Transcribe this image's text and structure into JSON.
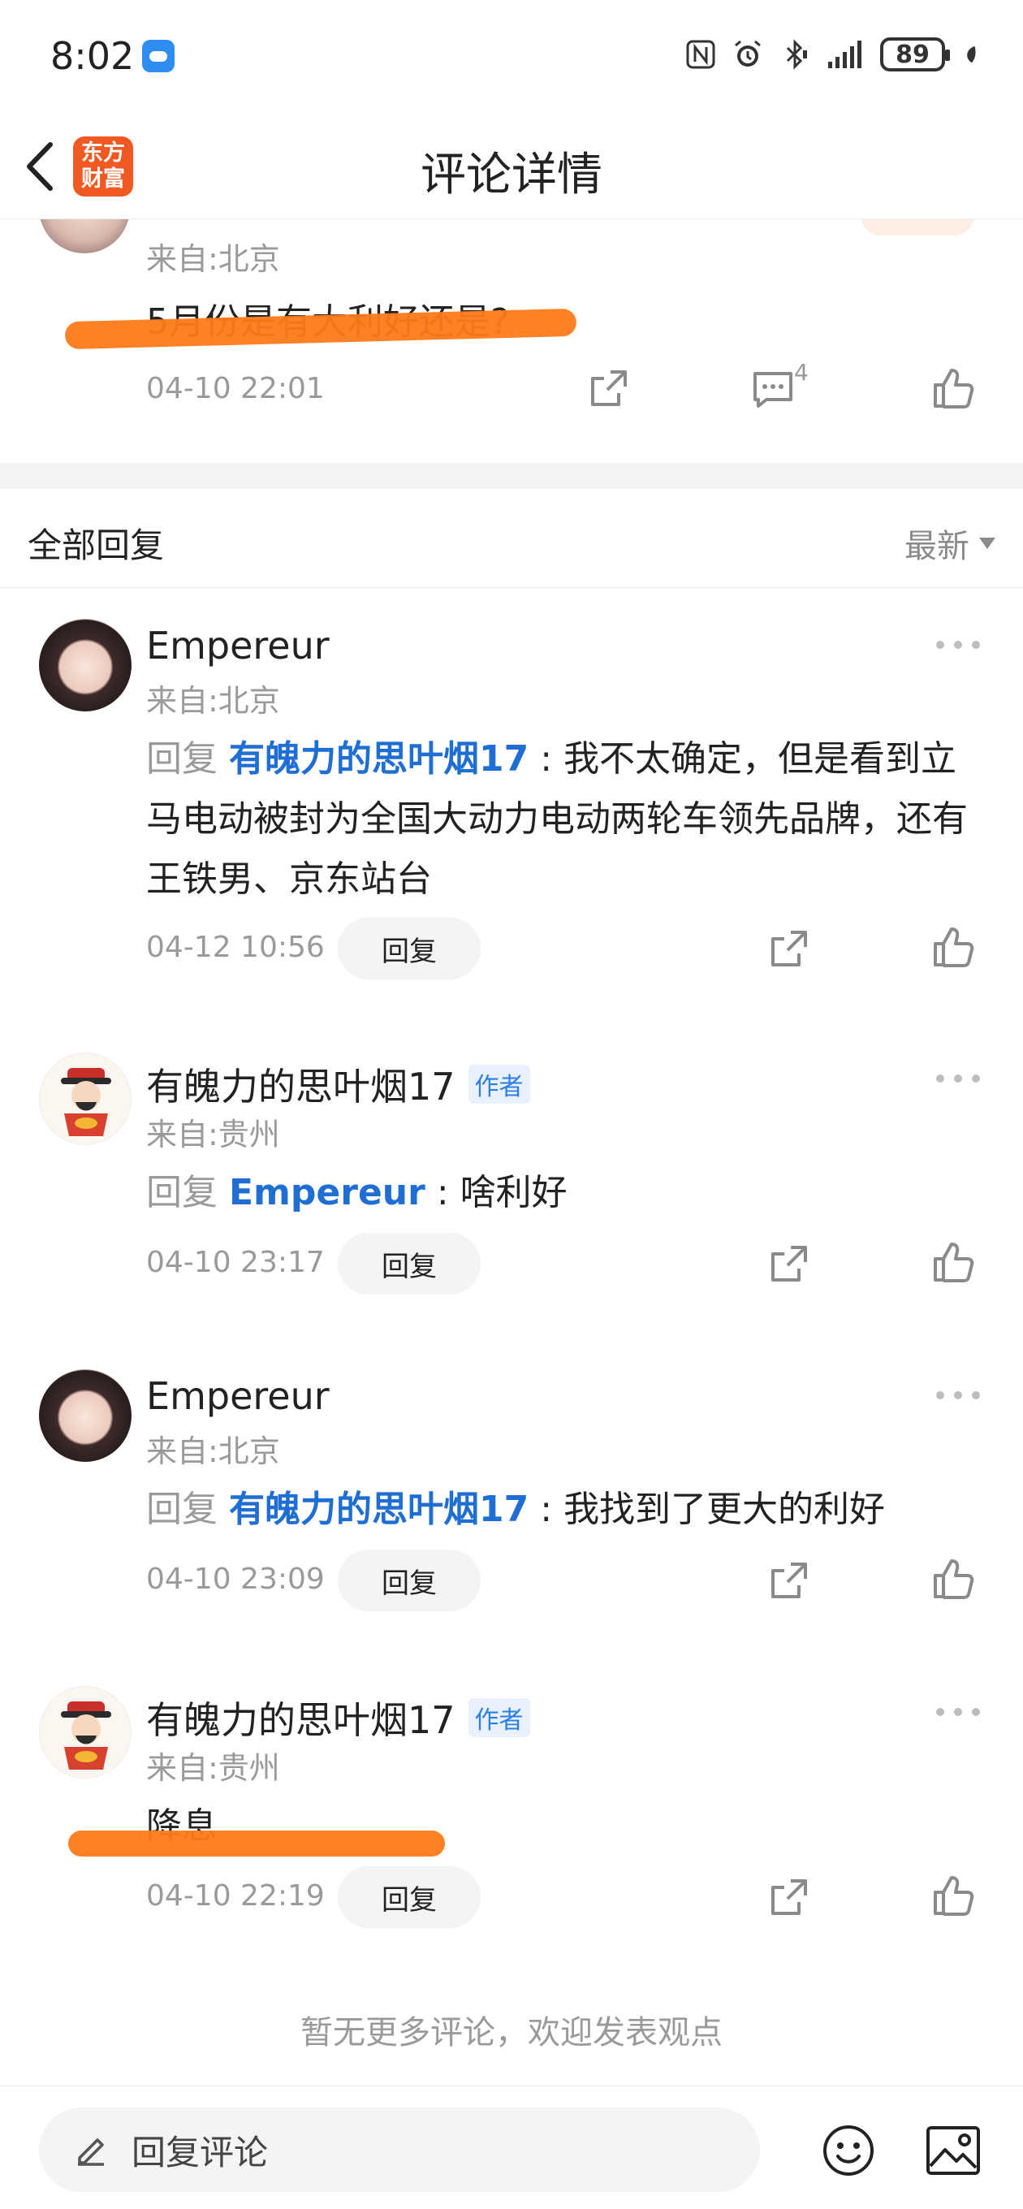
{
  "status_bar": {
    "time": "8:02",
    "battery": "89"
  },
  "header": {
    "title": "评论详情",
    "logo_line1": "东方",
    "logo_line2": "财富"
  },
  "origin_comment": {
    "location": "来自:北京",
    "text": "5月份是有大利好还是?",
    "time": "04-10 22:01",
    "reply_count": "4"
  },
  "replies_header": {
    "title": "全部回复",
    "sort": "最新"
  },
  "replies": [
    {
      "name": "Empereur",
      "location": "来自:北京",
      "prefix": "回复",
      "mention": "有魄力的思叶烟17",
      "colon": ":",
      "text": "我不太确定，但是看到立马电动被封为全国大动力电动两轮车领先品牌，还有王铁男、京东站台",
      "time": "04-12 10:56",
      "reply_label": "回复"
    },
    {
      "name": "有魄力的思叶烟17",
      "author_tag": "作者",
      "location": "来自:贵州",
      "prefix": "回复",
      "mention": "Empereur",
      "colon": ":",
      "text": "啥利好",
      "time": "04-10 23:17",
      "reply_label": "回复"
    },
    {
      "name": "Empereur",
      "location": "来自:北京",
      "prefix": "回复",
      "mention": "有魄力的思叶烟17",
      "colon": ":",
      "text": "我找到了更大的利好",
      "time": "04-10 23:09",
      "reply_label": "回复"
    },
    {
      "name": "有魄力的思叶烟17",
      "author_tag": "作者",
      "location": "来自:贵州",
      "text": "降息",
      "time": "04-10 22:19",
      "reply_label": "回复"
    }
  ],
  "footer_note": "暂无更多评论，欢迎发表观点",
  "bottom_bar": {
    "input_placeholder": "回复评论"
  },
  "colors": {
    "mention": "#1f6ed4",
    "author_tag": "#2f7ee6",
    "logo": "#f05a22",
    "highlight_scribble": "#ff7a1a"
  },
  "icons": [
    "back-icon",
    "share-icon",
    "comment-icon",
    "like-icon",
    "more-icon",
    "pen-icon",
    "emoji-icon",
    "image-icon"
  ]
}
